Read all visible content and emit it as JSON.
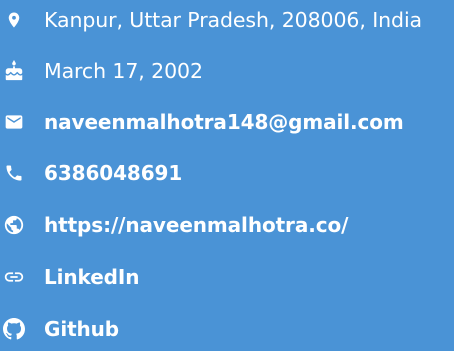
{
  "contact": {
    "address": "Kanpur, Uttar Pradesh, 208006, India",
    "birthday": "March 17, 2002",
    "email": "naveenmalhotra148@gmail.com",
    "phone": "6386048691",
    "website": "https://naveenmalhotra.co/",
    "linkedin": "LinkedIn",
    "github": "Github"
  },
  "icons": {
    "address": "location-pin-icon",
    "birthday": "cake-icon",
    "email": "mail-icon",
    "phone": "phone-icon",
    "website": "globe-icon",
    "linkedin": "link-icon",
    "github": "github-icon"
  },
  "colors": {
    "background": "#4a93d6",
    "text": "#ffffff"
  }
}
